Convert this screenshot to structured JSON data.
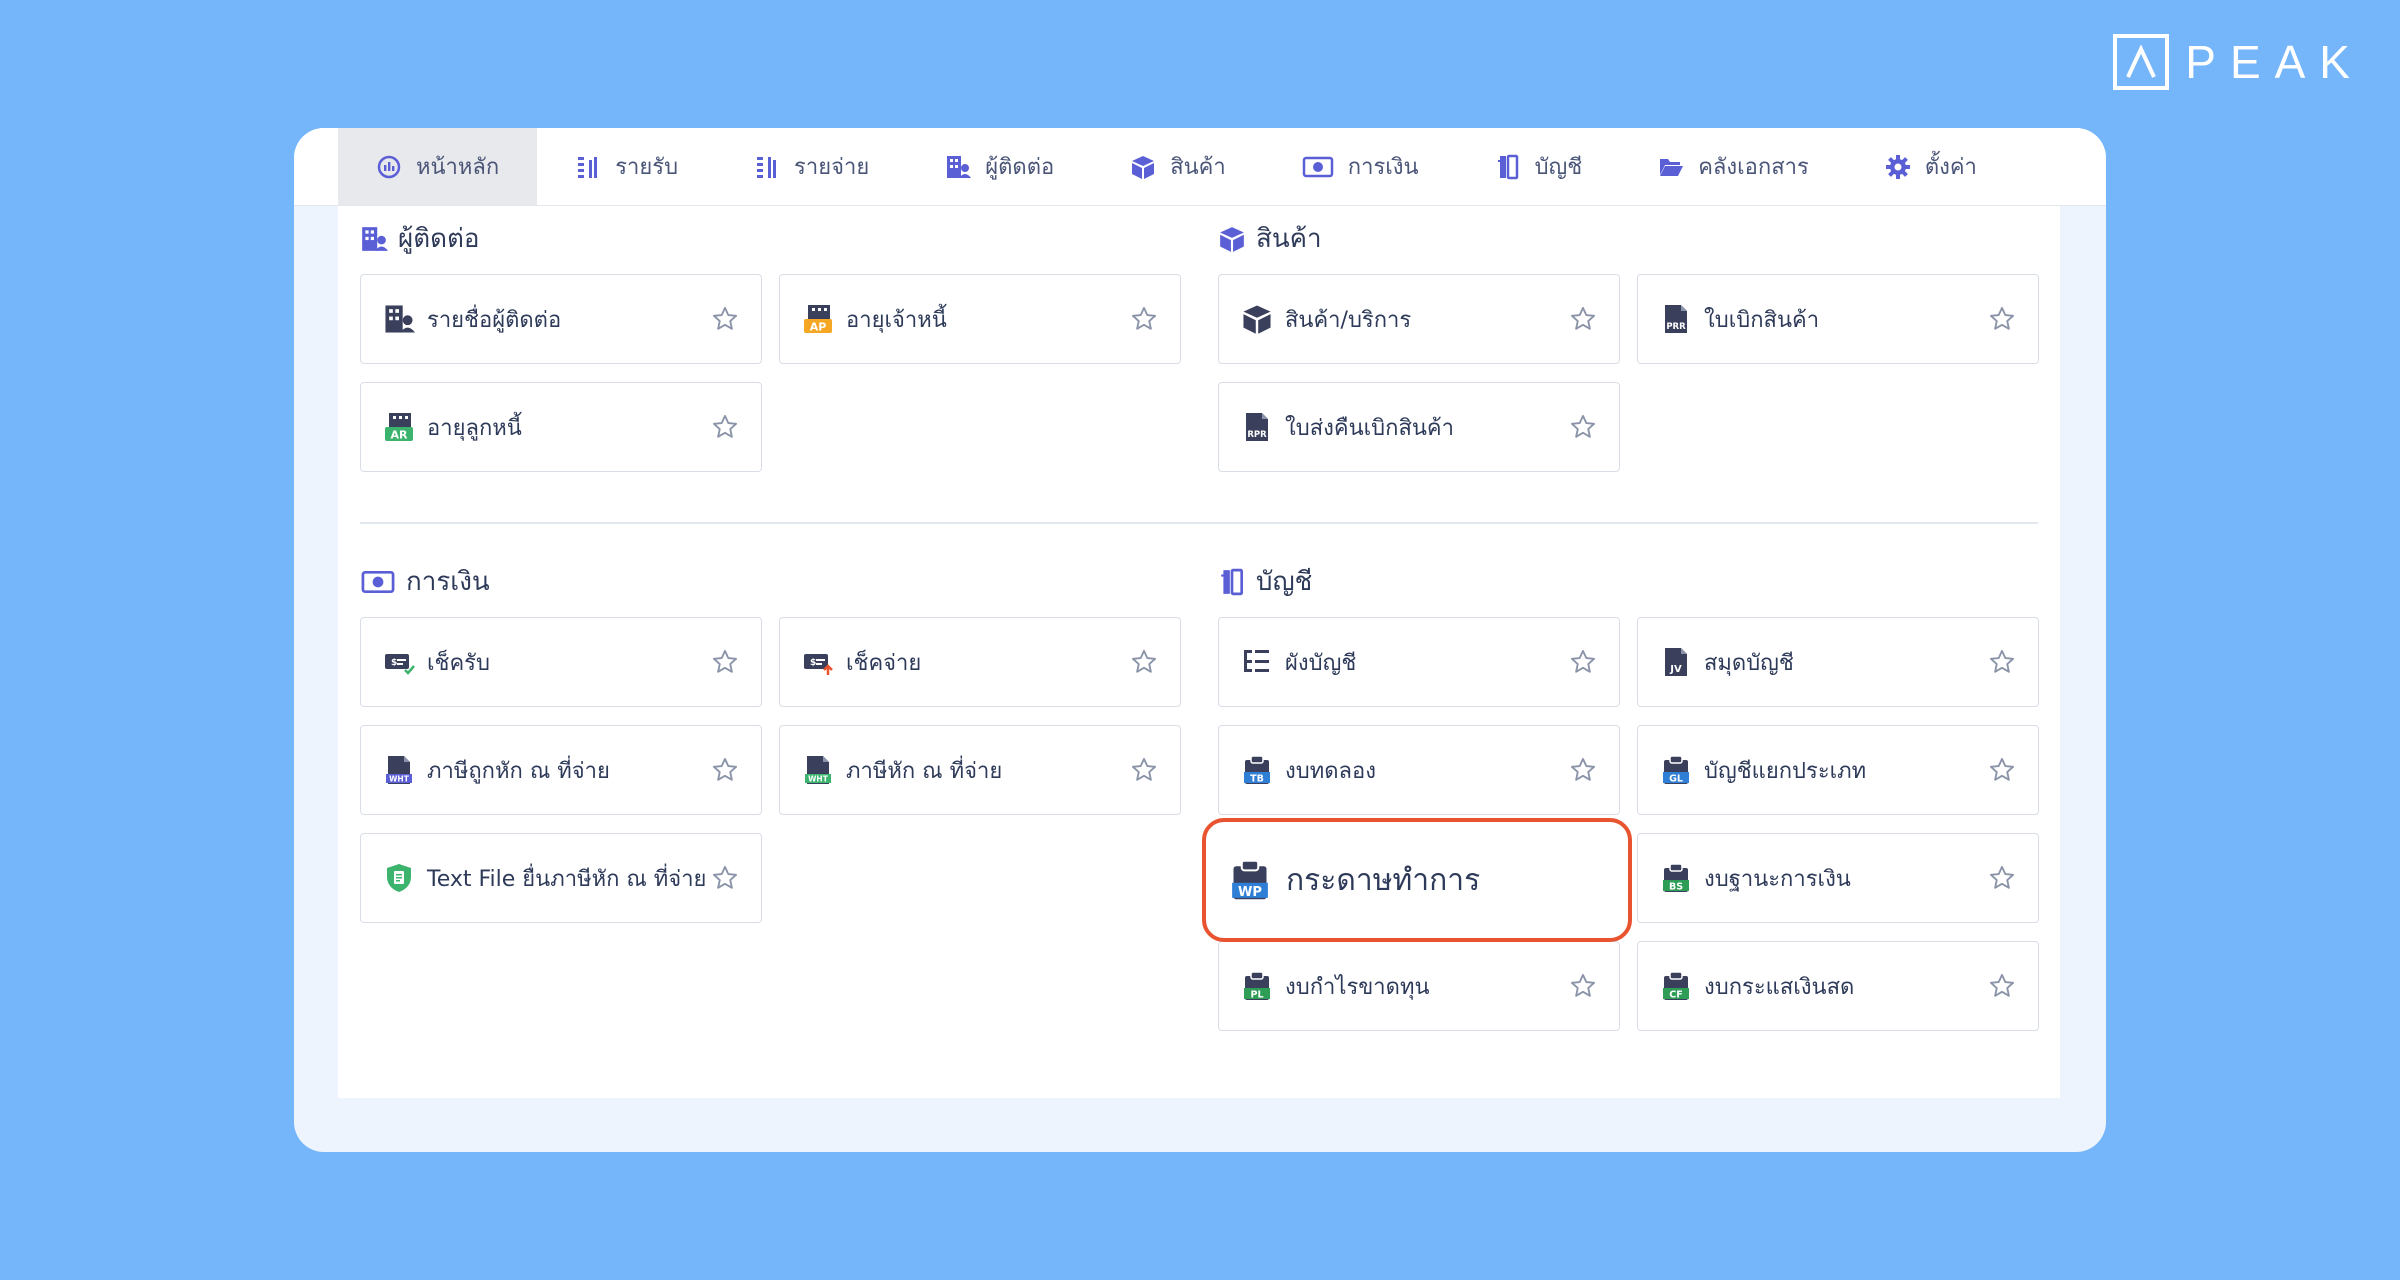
{
  "brand": {
    "name": "PEAK"
  },
  "colors": {
    "background": "#75b6fb",
    "accent": "#5b5fd6",
    "highlight": "#e8542f",
    "text": "#2e3a59"
  },
  "nav": [
    {
      "label": "หน้าหลัก",
      "icon": "dashboard-icon",
      "active": true
    },
    {
      "label": "รายรับ",
      "icon": "income-list-icon"
    },
    {
      "label": "รายจ่าย",
      "icon": "expense-list-icon"
    },
    {
      "label": "ผู้ติดต่อ",
      "icon": "contacts-icon"
    },
    {
      "label": "สินค้า",
      "icon": "box-icon"
    },
    {
      "label": "การเงิน",
      "icon": "money-icon"
    },
    {
      "label": "บัญชี",
      "icon": "ledger-icon"
    },
    {
      "label": "คลังเอกสาร",
      "icon": "folder-icon"
    },
    {
      "label": "ตั้งค่า",
      "icon": "gear-icon"
    }
  ],
  "sections": {
    "contacts": {
      "title": "ผู้ติดต่อ",
      "items": [
        {
          "label": "รายชื่อผู้ติดต่อ",
          "icon": "contacts-icon"
        },
        {
          "label": "อายุเจ้าหนี้",
          "icon": "ap-aging-icon",
          "badge": "AP"
        },
        {
          "label": "อายุลูกหนี้",
          "icon": "ar-aging-icon",
          "badge": "AR"
        }
      ]
    },
    "products": {
      "title": "สินค้า",
      "items": [
        {
          "label": "สินค้า/บริการ",
          "icon": "box-icon"
        },
        {
          "label": "ใบเบิกสินค้า",
          "icon": "prr-document-icon",
          "badge": "PRR"
        },
        {
          "label": "ใบส่งคืนเบิกสินค้า",
          "icon": "rpr-document-icon",
          "badge": "RPR"
        }
      ]
    },
    "finance": {
      "title": "การเงิน",
      "items": [
        {
          "label": "เช็ครับ",
          "icon": "cheque-received-icon"
        },
        {
          "label": "เช็คจ่าย",
          "icon": "cheque-paid-icon"
        },
        {
          "label": "ภาษีถูกหัก ณ ที่จ่าย",
          "icon": "wht-document-icon",
          "badge": "WHT"
        },
        {
          "label": "ภาษีหัก ณ ที่จ่าย",
          "icon": "wht-green-document-icon",
          "badge": "WHT"
        },
        {
          "label": "Text File ยื่นภาษีหัก ณ ที่จ่าย",
          "icon": "shield-file-icon"
        }
      ]
    },
    "accounting": {
      "title": "บัญชี",
      "items": [
        {
          "label": "ผังบัญชี",
          "icon": "chart-of-accounts-icon"
        },
        {
          "label": "สมุดบัญชี",
          "icon": "jv-document-icon",
          "badge": "JV"
        },
        {
          "label": "งบทดลอง",
          "icon": "tb-clipboard-icon",
          "badge": "TB"
        },
        {
          "label": "บัญชีแยกประเภท",
          "icon": "gl-clipboard-icon",
          "badge": "GL"
        },
        {
          "label": "กระดาษทำการ",
          "icon": "wp-clipboard-icon",
          "badge": "WP",
          "highlighted": true
        },
        {
          "label": "งบฐานะการเงิน",
          "icon": "bs-clipboard-icon",
          "badge": "BS"
        },
        {
          "label": "งบกำไรขาดทุน",
          "icon": "pl-clipboard-icon",
          "badge": "PL"
        },
        {
          "label": "งบกระแสเงินสด",
          "icon": "cf-clipboard-icon",
          "badge": "CF"
        }
      ]
    }
  }
}
